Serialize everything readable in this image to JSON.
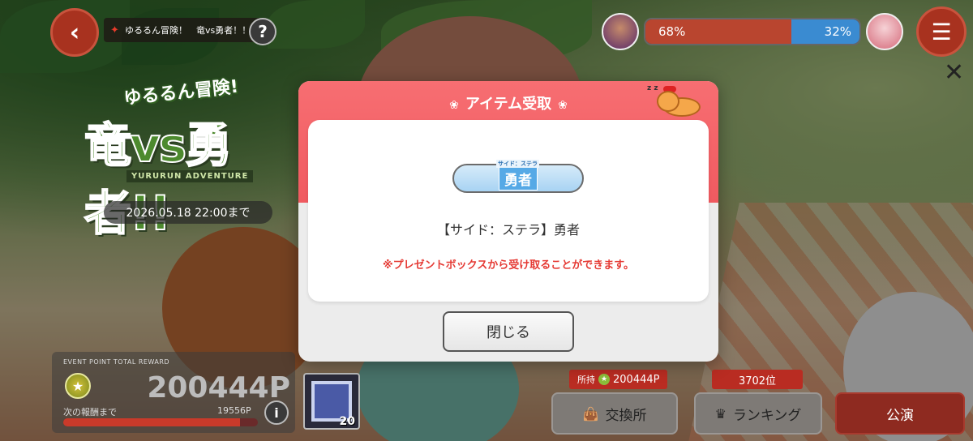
{
  "header": {
    "back_icon": "back-arrow-icon",
    "event_chip_label": "ゆるるん冒険！　竜vs勇者！！",
    "help_label": "?"
  },
  "event_logo": {
    "subtitle": "ゆるるん冒険!",
    "title": "竜vs勇者!!",
    "english": "YURURUN ADVENTURE"
  },
  "deadline": "2026.05.18 22:00まで",
  "versus": {
    "left_percent_label": "68%",
    "right_percent_label": "32%",
    "left_ratio": 0.68,
    "left_color": "#b9452f",
    "right_color": "#3a8bd1"
  },
  "menu_icon": "list-menu-icon",
  "reward": {
    "header": "EVENT POINT TOTAL REWARD",
    "points": "200444P",
    "next_label": "次の報酬まで",
    "remaining": "19556P",
    "progress_fraction": 0.91,
    "info_label": "i",
    "item_count": "20"
  },
  "bottom": {
    "owned_label": "所持",
    "owned_value": "200444P",
    "rank_value": "3702位",
    "exchange_label": "交換所",
    "ranking_label": "ランキング",
    "perform_label": "公演"
  },
  "dialog": {
    "title": "アイテム受取",
    "badge_text": "勇者",
    "badge_ruby": "サイド：ステラ",
    "item_name": "【サイド：ステラ】勇者",
    "notice": "※プレゼントボックスから受け取ることができます。",
    "close_label": "閉じる",
    "accent_color": "#f05a60",
    "notice_color": "#e53a34"
  }
}
